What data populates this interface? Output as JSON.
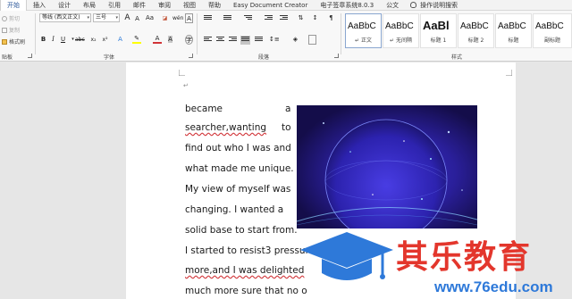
{
  "tabs": [
    {
      "label": "开始",
      "active": true
    },
    {
      "label": "插入"
    },
    {
      "label": "设计"
    },
    {
      "label": "布局"
    },
    {
      "label": "引用"
    },
    {
      "label": "邮件"
    },
    {
      "label": "审阅"
    },
    {
      "label": "视图"
    },
    {
      "label": "帮助"
    },
    {
      "label": "Easy Document Creator"
    },
    {
      "label": "电子签章系统8.0.3"
    },
    {
      "label": "公文"
    }
  ],
  "tell_me": "操作说明搜索",
  "clipboard": {
    "cut": "剪切",
    "copy": "复制",
    "format_painter": "格式刷",
    "group_label": "贴板"
  },
  "font": {
    "name": "等线 (西文正文)",
    "size": "三号",
    "group_label": "字体",
    "bold": "B",
    "italic": "I",
    "underline": "U",
    "strike": "abc",
    "subscript": "x₂",
    "superscript": "x²",
    "grow": "A",
    "shrink": "A",
    "font_color_letter": "A",
    "clear": "Aa",
    "phonetic": "wén",
    "border_char": "A",
    "font_color": "#d13438",
    "highlight_color": "#ffff00"
  },
  "paragraph": {
    "group_label": "段落"
  },
  "styles": {
    "group_label": "样式",
    "items": [
      {
        "sample": "AaBbC",
        "name": "↵ 正文",
        "active": true
      },
      {
        "sample": "AaBbC",
        "name": "↵ 无间隔"
      },
      {
        "sample": "AaBl",
        "name": "标题 1",
        "big": true
      },
      {
        "sample": "AaBbC",
        "name": "标题 2"
      },
      {
        "sample": "AaBbC",
        "name": "标题"
      },
      {
        "sample": "AaBbC",
        "name": "副标题"
      }
    ]
  },
  "document": {
    "para_mark": "↵",
    "lines": [
      {
        "a": "became",
        "b": "a"
      },
      {
        "a": "searcher,wanting",
        "b": "to"
      },
      {
        "a": "find out who I was and"
      },
      {
        "a": "what made me unique."
      },
      {
        "a": "My view of myself was"
      },
      {
        "a": "changing. I wanted a"
      },
      {
        "a": "solid base to start from."
      },
      {
        "a": "I started to resist3 pressure"
      },
      {
        "a": "more,and I was delighted"
      },
      {
        "a": "much more sure that no o"
      }
    ]
  },
  "watermark": {
    "title": "其乐教育",
    "url": "www.76edu.com"
  }
}
